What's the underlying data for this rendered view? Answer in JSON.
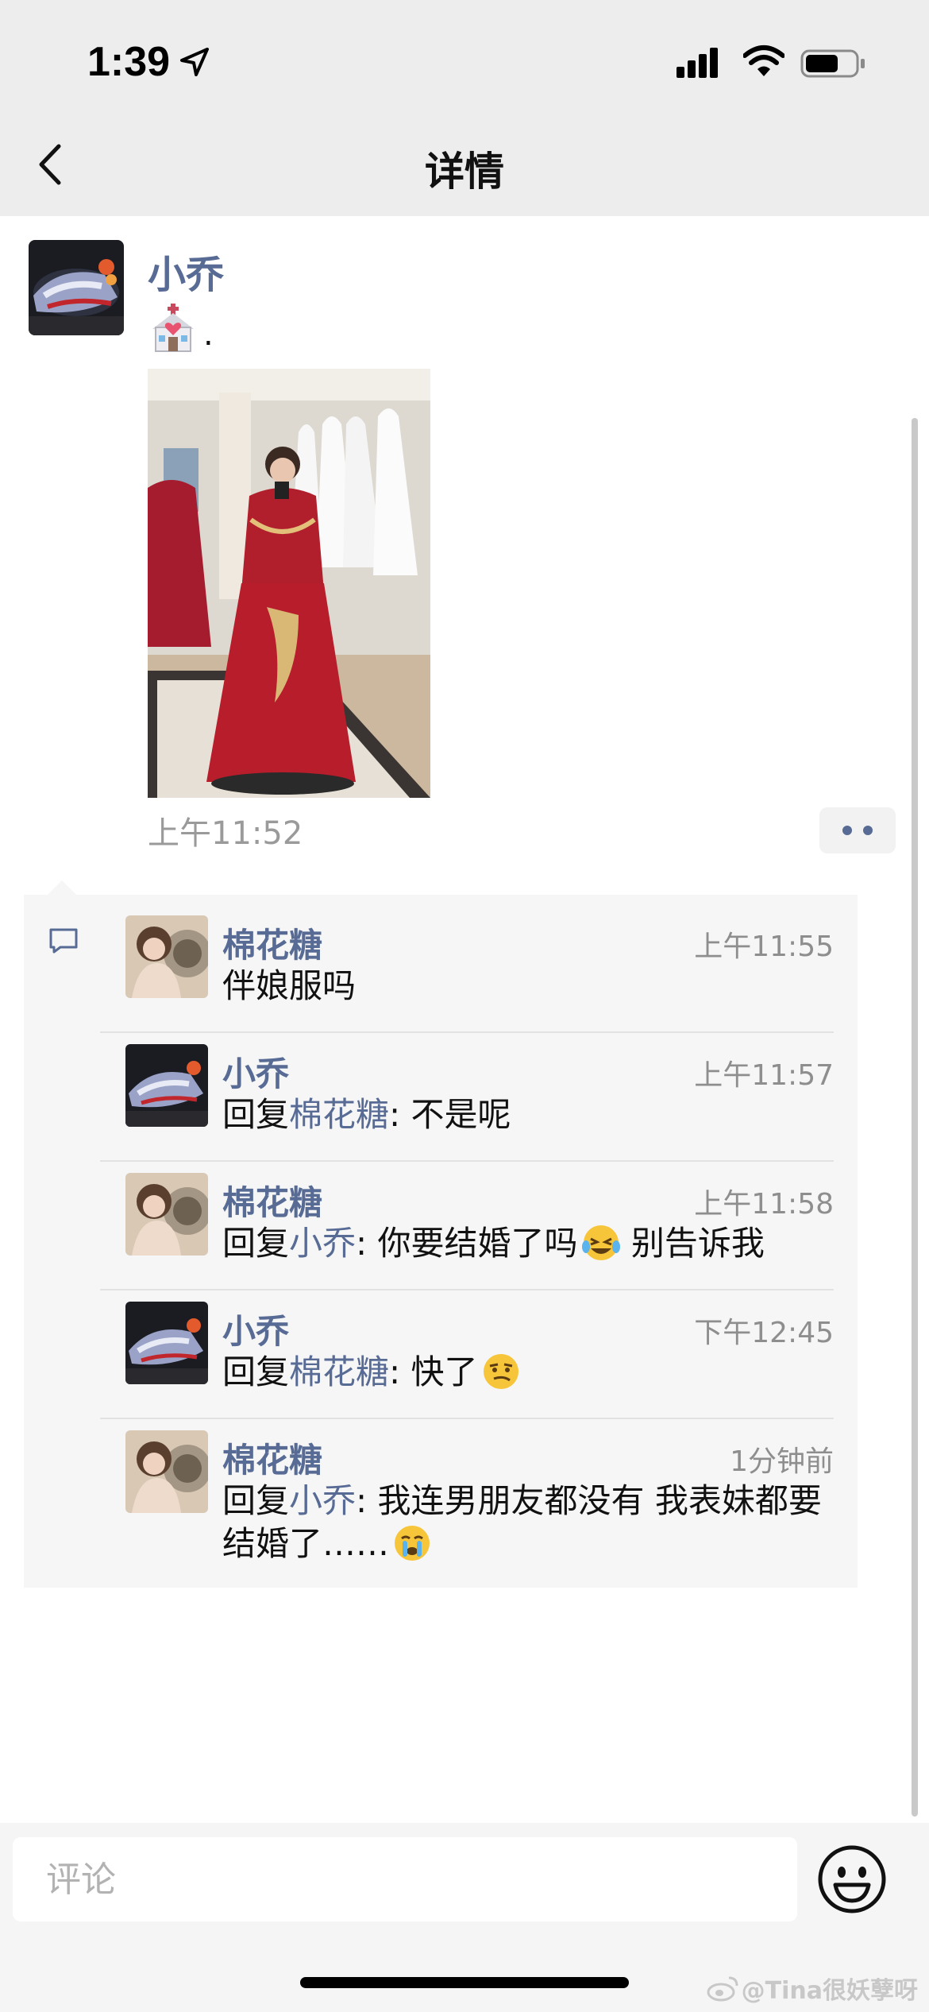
{
  "status_bar": {
    "time": "1:39"
  },
  "nav": {
    "title": "详情"
  },
  "post": {
    "author": "小乔",
    "text_suffix": ".",
    "time": "上午11:52"
  },
  "comments": [
    {
      "author": "棉花糖",
      "time": "上午11:55",
      "reply_prefix": "",
      "reply_to": "",
      "text": "伴娘服吗",
      "emoji": ""
    },
    {
      "author": "小乔",
      "time": "上午11:57",
      "reply_prefix": "回复",
      "reply_to": "棉花糖",
      "text": ": 不是呢",
      "emoji": ""
    },
    {
      "author": "棉花糖",
      "time": "上午11:58",
      "reply_prefix": "回复",
      "reply_to": "小乔",
      "text": ": 你要结婚了吗",
      "emoji": "laughing-crying-emoji",
      "text_after": " 别告诉我"
    },
    {
      "author": "小乔",
      "time": "下午12:45",
      "reply_prefix": "回复",
      "reply_to": "棉花糖",
      "text": ": 快了",
      "emoji": "smirk-emoji"
    },
    {
      "author": "棉花糖",
      "time": "1分钟前",
      "reply_prefix": "回复",
      "reply_to": "小乔",
      "text": ": 我连男朋友都没有 我表妹都要结婚了……",
      "emoji": "crying-emoji"
    }
  ],
  "input": {
    "placeholder": "评论"
  },
  "watermark": {
    "text": "@Tina很妖孽呀"
  },
  "colors": {
    "link": "#576b95",
    "panel": "#f6f6f6",
    "bar": "#ededed"
  }
}
